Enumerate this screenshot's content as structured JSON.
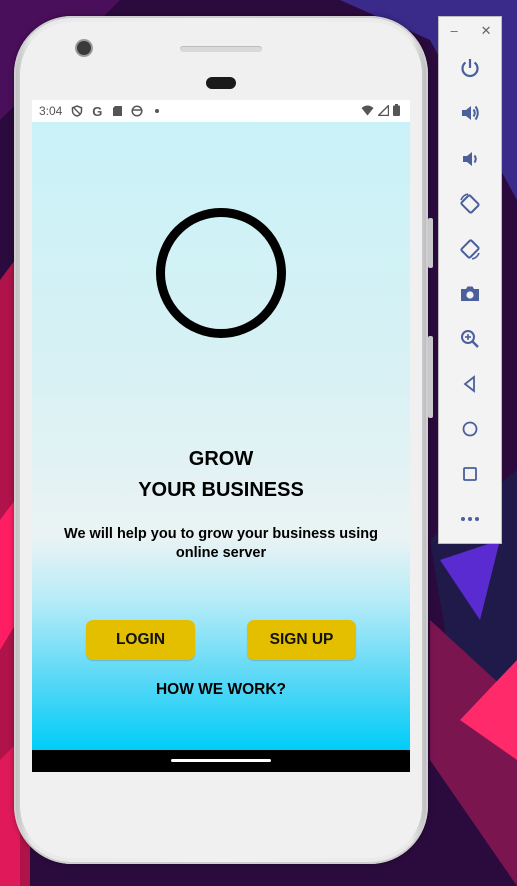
{
  "status_bar": {
    "time": "3:04"
  },
  "app": {
    "headline_line1": "GROW",
    "headline_line2": "YOUR BUSINESS",
    "subtext": "We will help you to grow your business using online server",
    "login_label": "LOGIN",
    "signup_label": "SIGN UP",
    "how_label": "HOW WE WORK?"
  },
  "toolbar": {
    "icons": [
      "power-icon",
      "volume-up-icon",
      "volume-down-icon",
      "rotate-left-icon",
      "rotate-right-icon",
      "camera-icon",
      "zoom-icon",
      "back-icon",
      "home-icon",
      "overview-icon",
      "more-icon"
    ]
  },
  "colors": {
    "button_bg": "#e3bf00",
    "gradient_top": "#c9f2f8",
    "gradient_bottom": "#00cdf7",
    "toolbar_icon": "#4a5f9c"
  }
}
